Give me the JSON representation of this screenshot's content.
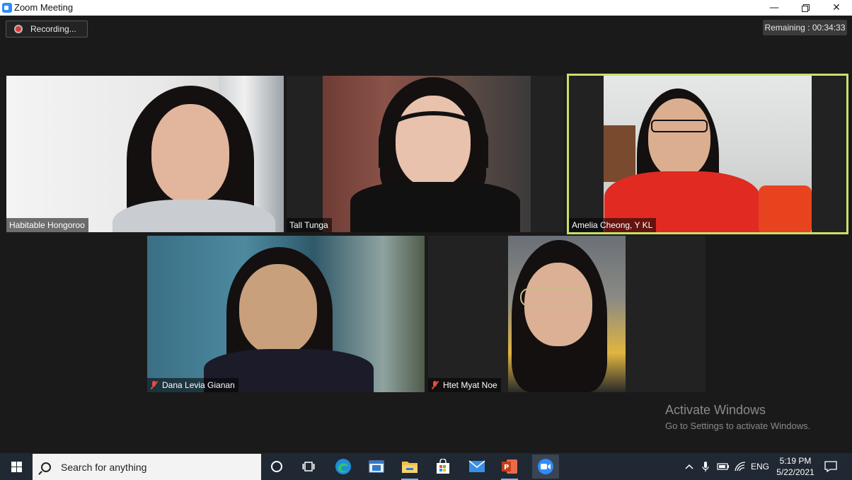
{
  "window": {
    "title": "Zoom Meeting"
  },
  "meeting": {
    "recording_label": "Recording...",
    "remaining_label": "Remaining : 00:34:33",
    "participants": [
      {
        "name": "Habitable Hongoroo",
        "muted": false,
        "speaking": false
      },
      {
        "name": "Tall Tunga",
        "muted": false,
        "speaking": false
      },
      {
        "name": "Amelia Cheong, Y KL",
        "muted": false,
        "speaking": true
      },
      {
        "name": "Dana Levia Gianan",
        "muted": true,
        "speaking": false
      },
      {
        "name": "Htet Myat Noe",
        "muted": true,
        "speaking": false
      }
    ],
    "speaker_highlight_color": "#c8e06a"
  },
  "watermark": {
    "title": "Activate Windows",
    "subtitle": "Go to Settings to activate Windows."
  },
  "taskbar": {
    "search_placeholder": "Search for anything",
    "icons": [
      "cortana-icon",
      "task-view-icon",
      "edge-icon",
      "window-icon",
      "file-explorer-icon",
      "store-icon",
      "mail-icon",
      "powerpoint-icon",
      "zoom-icon"
    ],
    "tray": {
      "language": "ENG"
    },
    "clock": {
      "time": "5:19 PM",
      "date": "5/22/2021"
    }
  }
}
